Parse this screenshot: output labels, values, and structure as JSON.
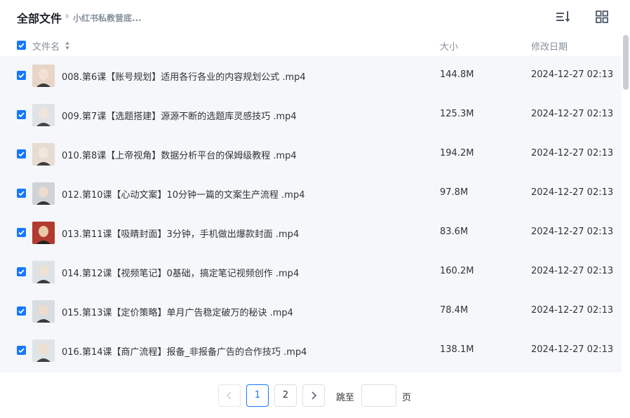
{
  "breadcrumb": {
    "root": "全部文件",
    "current": "小红书私教营底..."
  },
  "toolbar": {
    "sort_icon": "sort-list-icon",
    "view_icon": "grid-view-icon"
  },
  "columns": {
    "name": "文件名",
    "size": "大小",
    "date": "修改日期"
  },
  "files": [
    {
      "name": "008.第6课【账号规划】适用各行各业的内容规划公式 .mp4",
      "size": "144.8M",
      "date": "2024-12-27 02:13"
    },
    {
      "name": "009.第7课【选题搭建】源源不断的选题库灵感技巧 .mp4",
      "size": "125.3M",
      "date": "2024-12-27 02:13"
    },
    {
      "name": "010.第8课【上帝视角】数据分析平台的保姆级教程 .mp4",
      "size": "194.2M",
      "date": "2024-12-27 02:13"
    },
    {
      "name": "012.第10课【心动文案】10分钟一篇的文案生产流程 .mp4",
      "size": "97.8M",
      "date": "2024-12-27 02:13"
    },
    {
      "name": "013.第11课【吸睛封面】3分钟，手机做出爆款封面 .mp4",
      "size": "83.6M",
      "date": "2024-12-27 02:13"
    },
    {
      "name": "014.第12课【视频笔记】0基础，搞定笔记视频创作 .mp4",
      "size": "160.2M",
      "date": "2024-12-27 02:13"
    },
    {
      "name": "015.第13课【定价策略】单月广告稳定破万的秘诀 .mp4",
      "size": "78.4M",
      "date": "2024-12-27 02:13"
    },
    {
      "name": "016.第14课【商广流程】报备_非报备广告的合作技巧 .mp4",
      "size": "138.1M",
      "date": "2024-12-27 02:13"
    }
  ],
  "pagination": {
    "pages": [
      "1",
      "2"
    ],
    "current_page": "1",
    "jump_label": "跳至",
    "jump_value": "",
    "page_unit": "页"
  },
  "colors": {
    "accent": "#1677ff",
    "row_bg": "#f5f7fa",
    "muted_text": "#86909c"
  }
}
